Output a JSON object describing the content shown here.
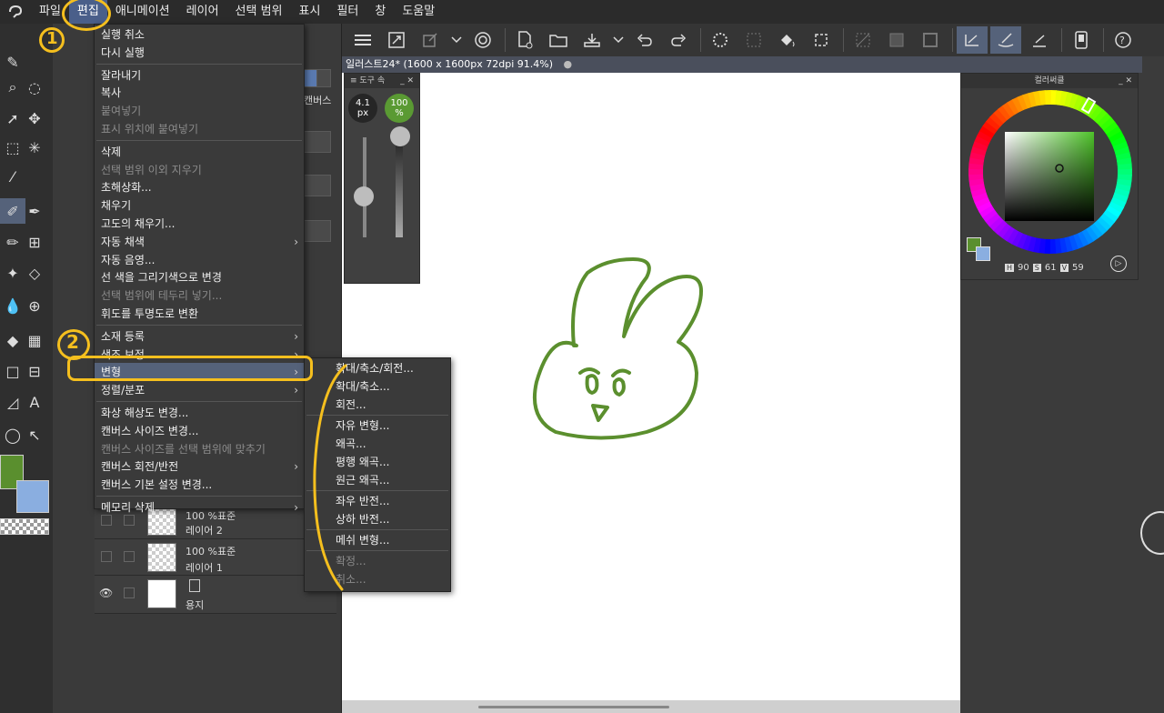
{
  "menubar": {
    "items": [
      "파일",
      "편집",
      "애니메이션",
      "레이어",
      "선택 범위",
      "표시",
      "필터",
      "창",
      "도움말"
    ],
    "active_index": 1
  },
  "subpanel": {
    "canvas_label": "캔버스"
  },
  "canvas": {
    "tab_title": "일러스트24* (1600 x 1600px 72dpi 91.4%)"
  },
  "brush_palette": {
    "title": "도구 속",
    "size_value": "4.1",
    "size_unit": "px",
    "opacity_value": "100",
    "opacity_unit": "%",
    "opacity_color": "#5a9a33"
  },
  "color_palette": {
    "title": "컬러써클",
    "h_label": "H",
    "h_value": "90",
    "s_label": "S",
    "s_value": "61",
    "v_label": "V",
    "v_value": "59",
    "main_color": "#5a8f2e",
    "sub_color": "#8aaee0"
  },
  "layers": [
    {
      "mode": "100 %표준",
      "name": "레이어 2"
    },
    {
      "mode": "100 %표준",
      "name": "레이어 1"
    },
    {
      "mode": "",
      "name": "용지"
    }
  ],
  "edit_menu": {
    "items": [
      {
        "label": "실행 취소",
        "disabled": false,
        "submenu": false
      },
      {
        "label": "다시 실행",
        "disabled": false,
        "submenu": false
      },
      {
        "label": "잘라내기",
        "disabled": false,
        "submenu": false
      },
      {
        "label": "복사",
        "disabled": false,
        "submenu": false
      },
      {
        "label": "붙여넣기",
        "disabled": true,
        "submenu": false
      },
      {
        "label": "표시 위치에 붙여넣기",
        "disabled": true,
        "submenu": false
      },
      {
        "label": "삭제",
        "disabled": false,
        "submenu": false
      },
      {
        "label": "선택 범위 이외 지우기",
        "disabled": true,
        "submenu": false
      },
      {
        "label": "초해상화...",
        "disabled": false,
        "submenu": false
      },
      {
        "label": "채우기",
        "disabled": false,
        "submenu": false
      },
      {
        "label": "고도의 채우기...",
        "disabled": false,
        "submenu": false
      },
      {
        "label": "자동 채색",
        "disabled": false,
        "submenu": true
      },
      {
        "label": "자동 음영...",
        "disabled": false,
        "submenu": false
      },
      {
        "label": "선 색을 그리기색으로 변경",
        "disabled": false,
        "submenu": false
      },
      {
        "label": "선택 범위에 테두리 넣기...",
        "disabled": true,
        "submenu": false
      },
      {
        "label": "휘도를 투명도로 변환",
        "disabled": false,
        "submenu": false
      },
      {
        "label": "소재 등록",
        "disabled": false,
        "submenu": true
      },
      {
        "label": "색조 보정",
        "disabled": false,
        "submenu": true
      },
      {
        "label": "변형",
        "disabled": false,
        "submenu": true
      },
      {
        "label": "정렬/분포",
        "disabled": false,
        "submenu": true
      },
      {
        "label": "화상 해상도 변경...",
        "disabled": false,
        "submenu": false
      },
      {
        "label": "캔버스 사이즈 변경...",
        "disabled": false,
        "submenu": false
      },
      {
        "label": "캔버스 사이즈를 선택 범위에 맞추기",
        "disabled": true,
        "submenu": false
      },
      {
        "label": "캔버스 회전/반전",
        "disabled": false,
        "submenu": true
      },
      {
        "label": "캔버스 기본 설정 변경...",
        "disabled": false,
        "submenu": false
      },
      {
        "label": "메모리 삭제",
        "disabled": false,
        "submenu": true
      }
    ]
  },
  "transform_submenu": {
    "items": [
      {
        "label": "확대/축소/회전...",
        "disabled": false
      },
      {
        "label": "확대/축소...",
        "disabled": false
      },
      {
        "label": "회전...",
        "disabled": false
      },
      {
        "label": "자유 변형...",
        "disabled": false
      },
      {
        "label": "왜곡...",
        "disabled": false
      },
      {
        "label": "평행 왜곡...",
        "disabled": false
      },
      {
        "label": "원근 왜곡...",
        "disabled": false
      },
      {
        "label": "좌우 반전...",
        "disabled": false
      },
      {
        "label": "상하 반전...",
        "disabled": false
      },
      {
        "label": "메쉬 변형...",
        "disabled": false
      },
      {
        "label": "확정...",
        "disabled": true
      },
      {
        "label": "취소...",
        "disabled": true
      }
    ]
  },
  "annotations": {
    "step1": "1",
    "step2": "2",
    "color": "#f5bf1e"
  },
  "drawing": {
    "stroke_color": "#5b8f2e"
  }
}
